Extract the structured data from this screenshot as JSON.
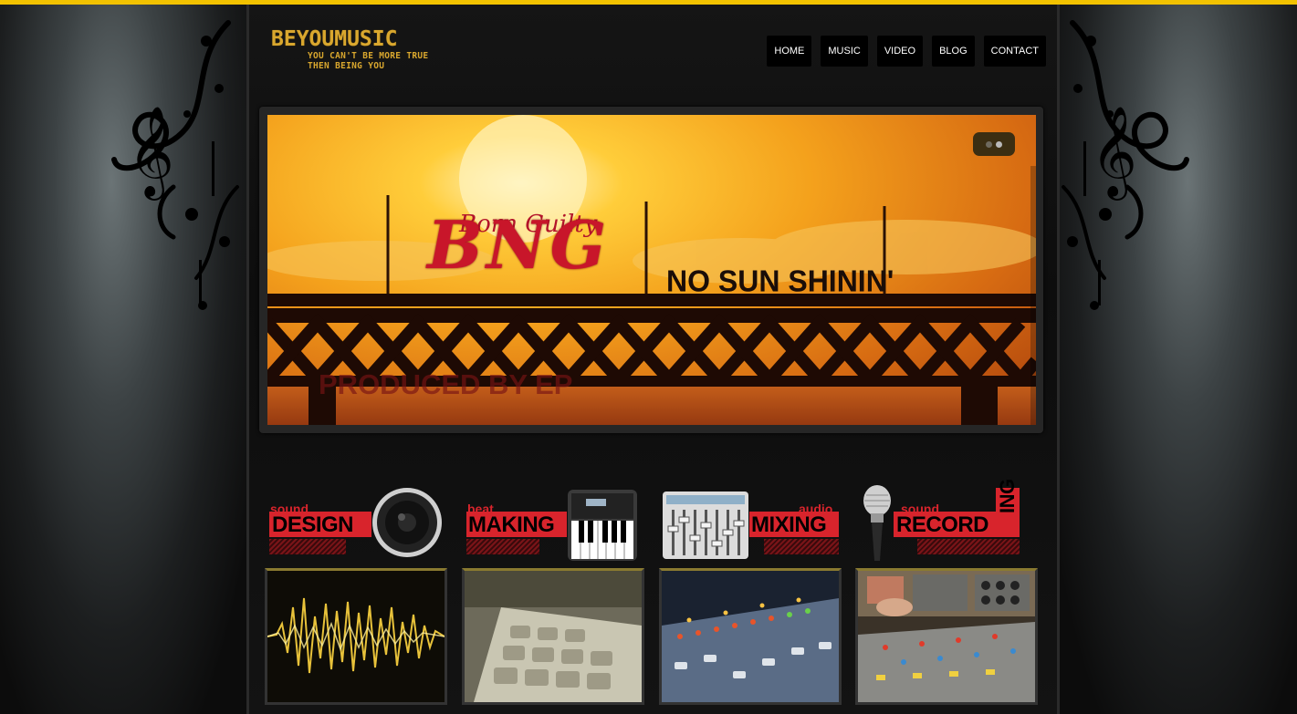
{
  "logo": {
    "main": "BEYOUMUSIC",
    "tagline_line1": "YOU CAN'T BE MORE TRUE",
    "tagline_line2": "THEN BEING YOU"
  },
  "nav": [
    "HOME",
    "MUSIC",
    "VIDEO",
    "BLOG",
    "CONTACT"
  ],
  "slider": {
    "artist_script": "Born Guilty",
    "artist_initials": "BNG",
    "song_title": "NO SUN SHININ'",
    "credit": "PRODUCED BY EP"
  },
  "services": [
    {
      "small": "sound",
      "big": "DESIGN",
      "icon": "speaker-icon"
    },
    {
      "small": "beat",
      "big": "MAKING",
      "icon": "keyboard-icon"
    },
    {
      "small": "audio",
      "big": "MIXING",
      "icon": "mixer-icon"
    },
    {
      "small": "sound",
      "big": "RECORD",
      "big_suffix": "ING",
      "icon": "microphone-icon"
    }
  ],
  "colors": {
    "accent": "#f2c200",
    "brand_red": "#d8242c",
    "logo_gold": "#d9a72e"
  }
}
